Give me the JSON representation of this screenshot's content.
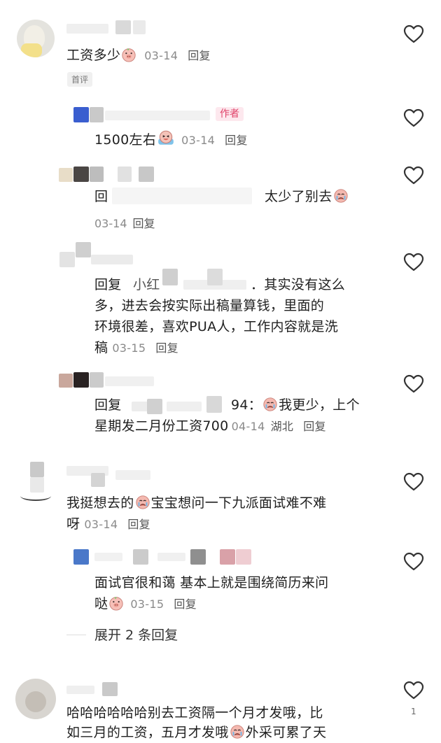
{
  "comments": [
    {
      "text": "工资多少",
      "date": "03-14",
      "reply_label": "回复",
      "badge": "首评",
      "replies": [
        {
          "author_tag": "作者",
          "text": "1500左右",
          "date": "03-14",
          "reply_label": "回复"
        },
        {
          "text_prefix": "回",
          "text": "太少了别去",
          "date": "03-14",
          "reply_label": "回复"
        },
        {
          "text_prefix": "回复",
          "mention": "小红",
          "text_line1": "．其实没有这么",
          "text_line2": "多，进去会按实际出稿量算钱，里面的",
          "text_line3": "环境很差，喜欢PUA人，工作内容就是洗",
          "text_line4": "稿",
          "date": "03-15",
          "reply_label": "回复"
        },
        {
          "text_prefix": "回复",
          "mention_suffix": "94：",
          "text_line1": "我更少，上个",
          "text_line2": "星期发二月份工资700",
          "date": "04-14",
          "location": "湖北",
          "reply_label": "回复"
        }
      ]
    },
    {
      "text_line1a": "我挺想去的",
      "text_line1b": "宝宝想问一下九派面试难不难",
      "text_line2": "呀",
      "date": "03-14",
      "reply_label": "回复",
      "replies": [
        {
          "text_line1": "面试官很和蔼 基本上就是围绕简历来问",
          "text_line2": "哒",
          "date": "03-15",
          "reply_label": "回复"
        }
      ],
      "expand_label": "展开 2 条回复"
    },
    {
      "text_line1": "哈哈哈哈哈哈别去工资隔一个月才发哦，比",
      "text_line2a": "如三月的工资，五月才发哦",
      "text_line2b": "外采可累了天",
      "like_count": "1"
    }
  ],
  "colors": {
    "meta": "#8a8a8a",
    "author_tag": "#e0436a",
    "heart_stroke": "#333333"
  },
  "icons": [
    "heart-icon",
    "laughing-emoji-icon",
    "crying-emoji-icon",
    "pig-emoji-icon"
  ]
}
